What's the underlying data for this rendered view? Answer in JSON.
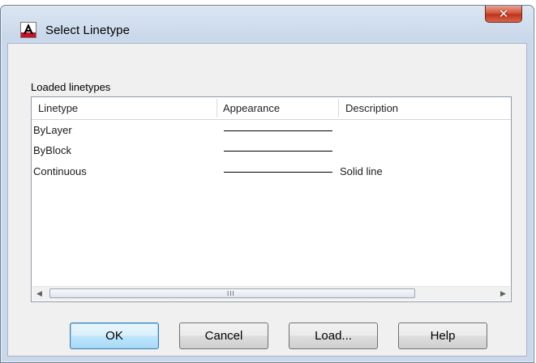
{
  "window": {
    "title": "Select Linetype",
    "app_icon": "autocad-app-icon",
    "close_glyph": "✕"
  },
  "group": {
    "label": "Loaded linetypes"
  },
  "table": {
    "columns": [
      "Linetype",
      "Appearance",
      "Description"
    ],
    "rows": [
      {
        "linetype": "ByLayer",
        "appearance": "solid-line",
        "description": ""
      },
      {
        "linetype": "ByBlock",
        "appearance": "solid-line",
        "description": ""
      },
      {
        "linetype": "Continuous",
        "appearance": "solid-line",
        "description": "Solid line"
      }
    ]
  },
  "scrollbar": {
    "left_arrow": "◀",
    "right_arrow": "▶",
    "grip": "III"
  },
  "buttons": {
    "ok": "OK",
    "cancel": "Cancel",
    "load": "Load...",
    "help": "Help"
  },
  "colors": {
    "close_button": "#c1331a",
    "default_button_border": "#3c7fb1",
    "icon_red": "#c8102e"
  }
}
